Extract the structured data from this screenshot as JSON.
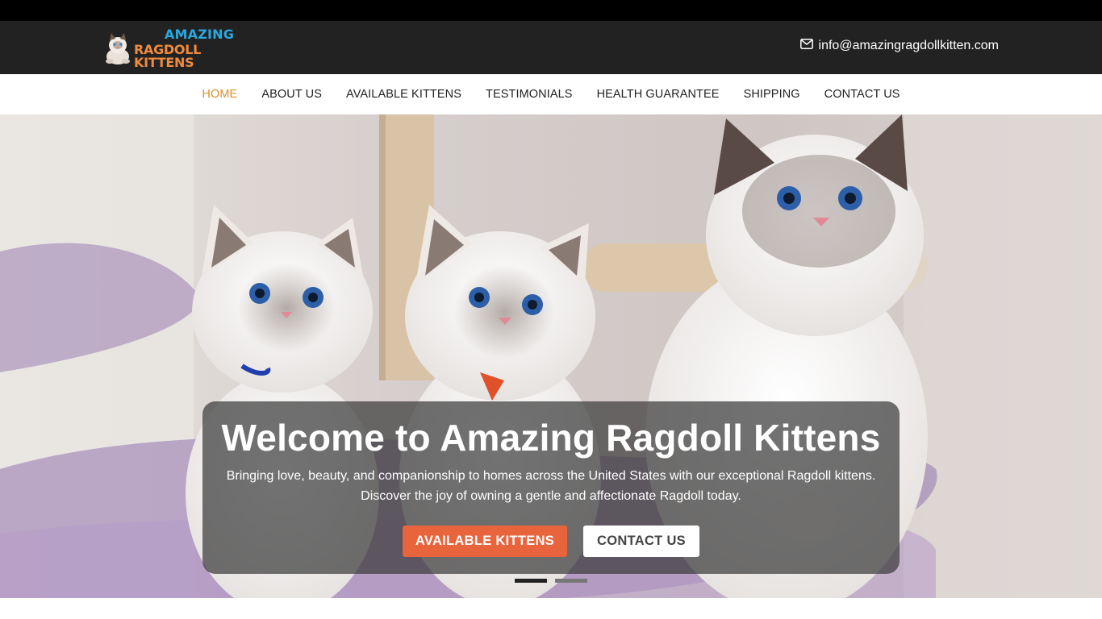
{
  "header": {
    "logo_line1": "AMAZING",
    "logo_line2": "RAGDOLL KITTENS",
    "email": "info@amazingragdollkitten.com",
    "email_icon": "envelope-icon"
  },
  "nav": {
    "items": [
      {
        "label": "HOME",
        "active": true
      },
      {
        "label": "ABOUT US",
        "active": false
      },
      {
        "label": "AVAILABLE KITTENS",
        "active": false
      },
      {
        "label": "TESTIMONIALS",
        "active": false
      },
      {
        "label": "HEALTH GUARANTEE",
        "active": false
      },
      {
        "label": "SHIPPING",
        "active": false
      },
      {
        "label": "CONTACT US",
        "active": false
      }
    ]
  },
  "hero": {
    "title": "Welcome to Amazing Ragdoll Kittens",
    "text_line1": "Bringing love, beauty, and companionship to homes across the United States with our exceptional Ragdoll kittens.",
    "text_line2": "Discover the joy of owning a gentle and affectionate Ragdoll today.",
    "primary_button": "AVAILABLE KITTENS",
    "secondary_button": "CONTACT US",
    "slides": 2,
    "active_slide": 1
  },
  "colors": {
    "top_strip": "#000000",
    "header_bg": "#222222",
    "logo_blue": "#29a8e0",
    "logo_orange": "#f08a3c",
    "nav_active": "#d9902e",
    "primary_button": "#e8643d",
    "indicator_active": "#222222",
    "indicator_inactive": "#777777"
  }
}
